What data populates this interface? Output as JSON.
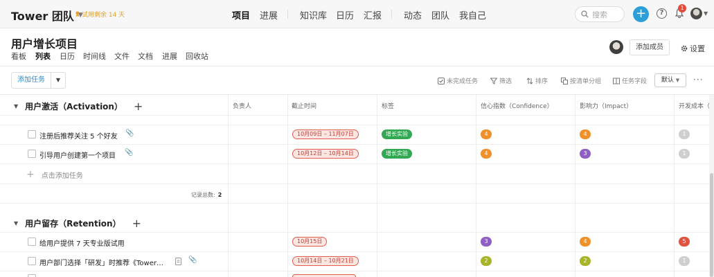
{
  "topbar": {
    "brand": "Tower 团队",
    "trial": "试用剩余 14 天",
    "nav": [
      "项目",
      "进展",
      "知识库",
      "日历",
      "汇报",
      "动态",
      "团队",
      "我自己"
    ],
    "active_nav": "项目",
    "search_placeholder": "搜索",
    "notification_count": "1",
    "plus": "+",
    "help": "?"
  },
  "project": {
    "title": "用户增长项目",
    "tabs": [
      "看板",
      "列表",
      "日历",
      "时间线",
      "文件",
      "文档",
      "进展",
      "回收站"
    ],
    "active_tab": "列表",
    "add_member": "添加成员",
    "settings": "设置"
  },
  "toolbar": {
    "add_task": "添加任务",
    "tools": [
      "未完成任务",
      "筛选",
      "排序",
      "按清单分组",
      "任务字段"
    ],
    "default_label": "默认",
    "more": "···"
  },
  "columns": [
    "负责人",
    "截止时间",
    "标签",
    "信心指数（Confidence）",
    "影响力（Impact）",
    "开发成本（Eff"
  ],
  "groups": [
    {
      "title": "用户激活（Activation）",
      "tasks": [
        {
          "name": "注册后推荐关注 5 个好友",
          "due": "10月09日 – 11月07日",
          "tag": "增长实验",
          "confidence": "4",
          "impact": "4",
          "effort": "1"
        },
        {
          "name": "引导用户创建第一个项目",
          "due": "10月12日 – 10月14日",
          "tag": "增长实验",
          "confidence": "4",
          "impact": "3",
          "effort": "1"
        }
      ],
      "add_task": "点击添加任务",
      "count_label": "记录总数:",
      "count": "2"
    },
    {
      "title": "用户留存（Retention）",
      "tasks": [
        {
          "name": "给用户提供 7 天专业版试用",
          "due": "10月15日",
          "tag": "",
          "confidence": "3",
          "impact": "4",
          "effort": "5"
        },
        {
          "name": "用户部门选择「研发」时推荐《Tower…",
          "due": "10月14日 – 10月21日",
          "tag": "",
          "confidence": "2",
          "impact": "2",
          "effort": "1"
        }
      ]
    }
  ],
  "colors": {
    "accent": "#2d9fd8",
    "date_border": "#e35b4d",
    "tag": "#33a853",
    "orange": "#f0902a",
    "purple": "#8e5fc4",
    "red": "#e0533e",
    "olive": "#a8b42a",
    "grey": "#cfcfcf"
  }
}
